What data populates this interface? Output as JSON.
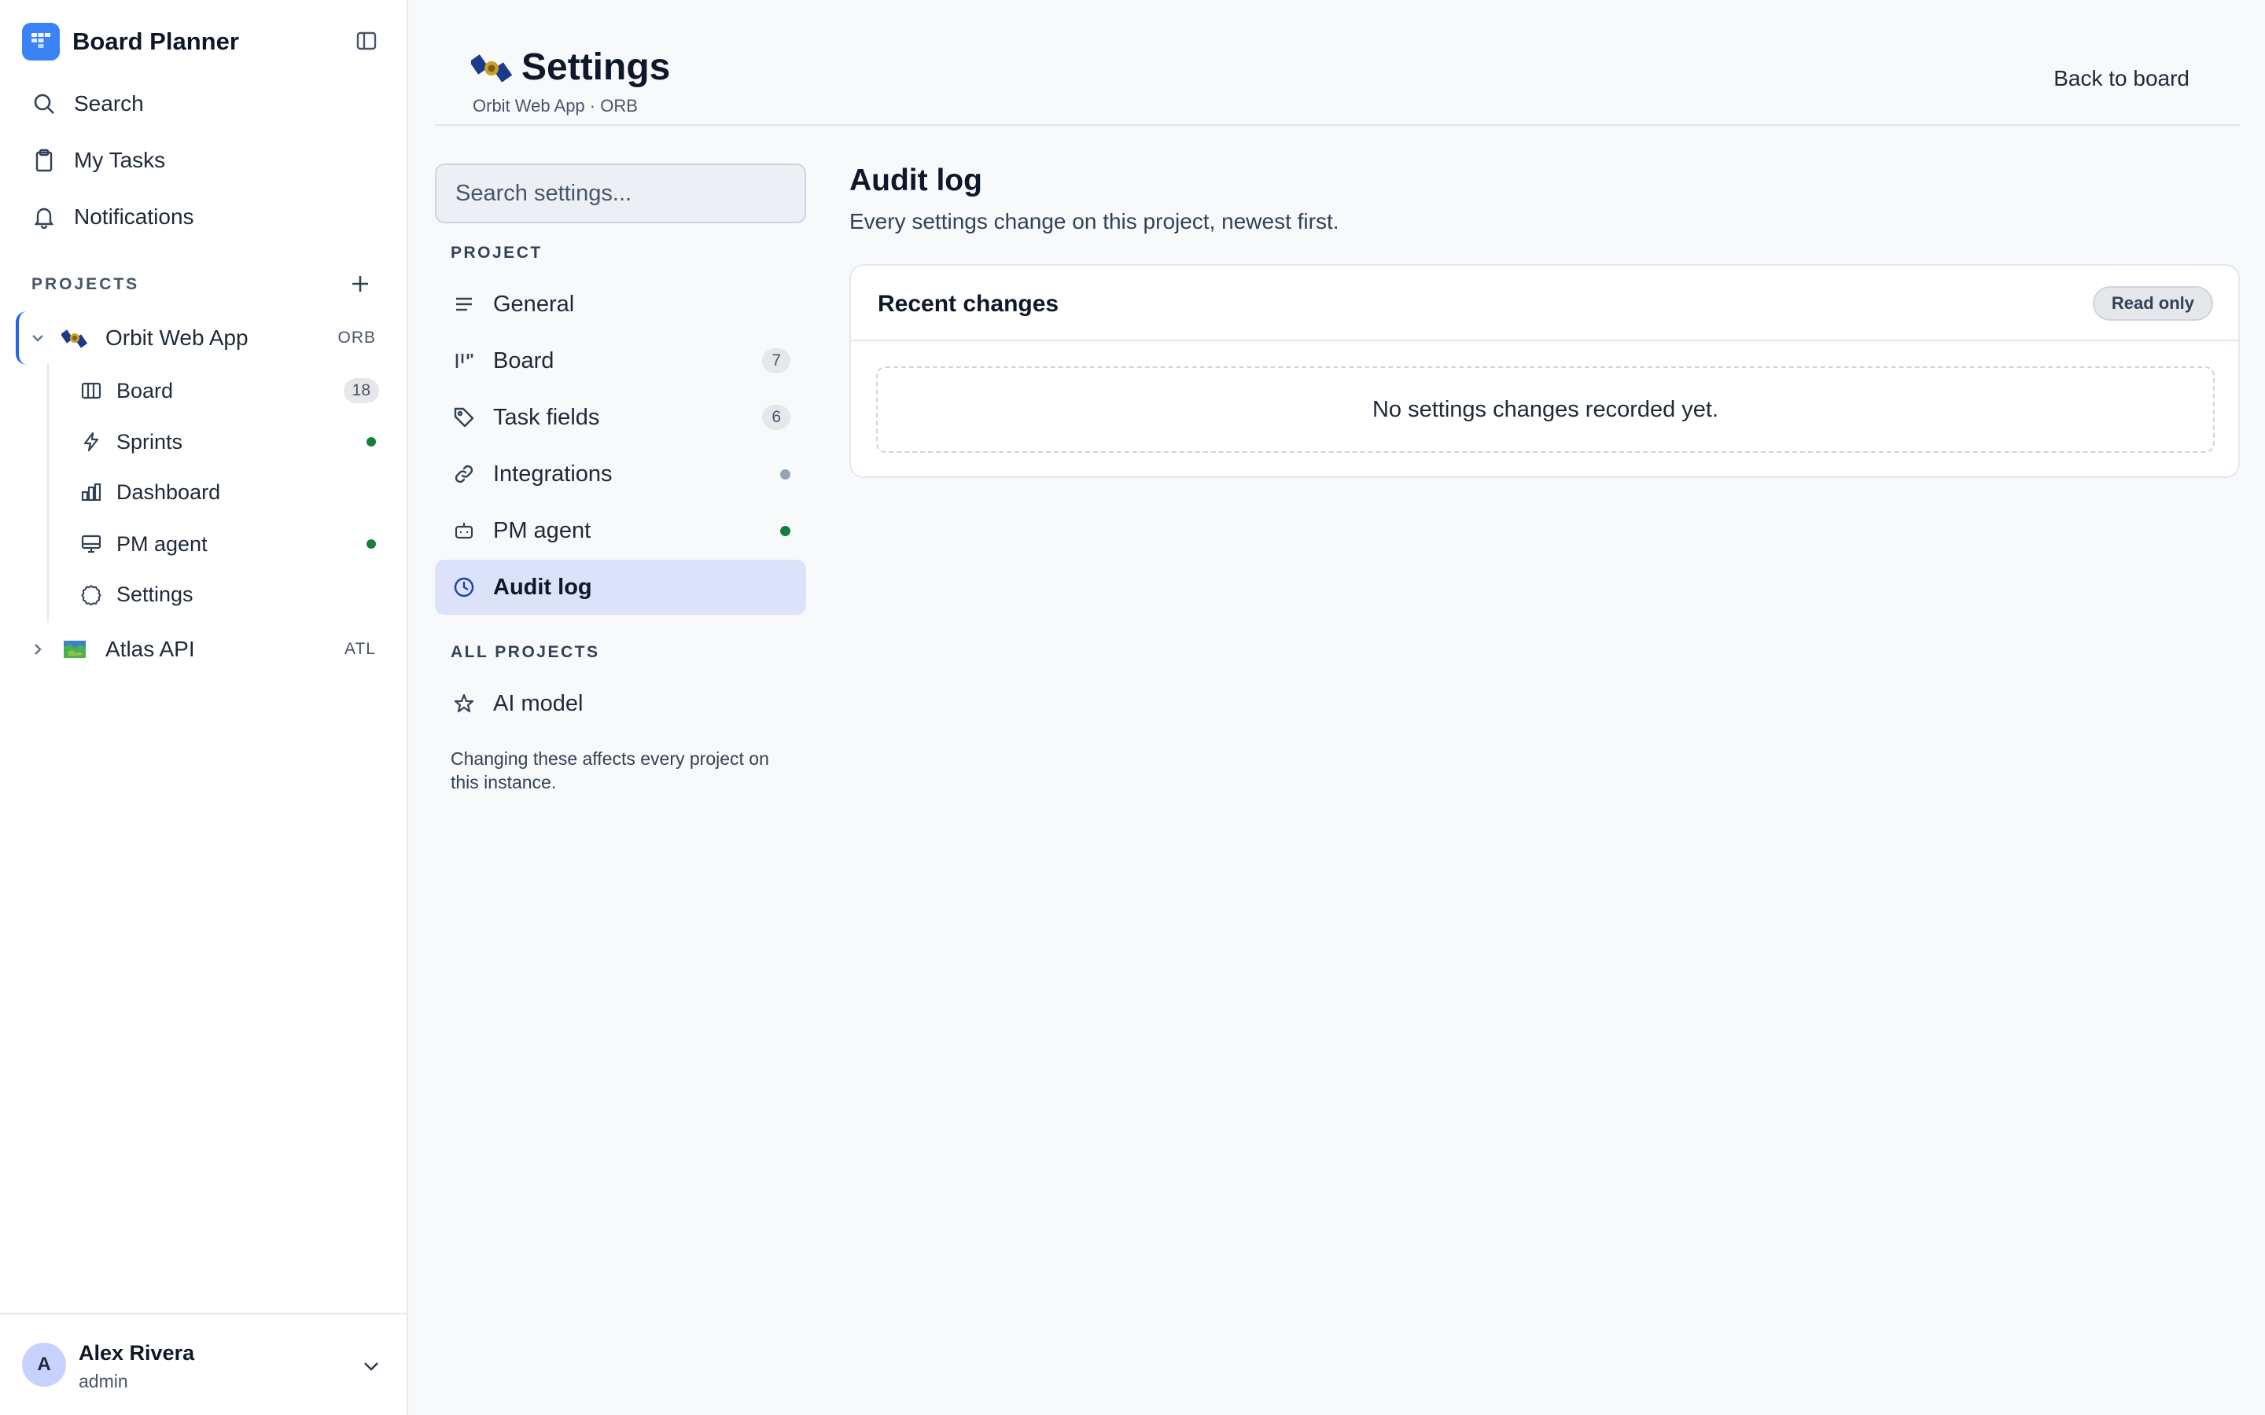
{
  "app": {
    "name": "Board Planner",
    "brand_color": "#3b82f6"
  },
  "sidebar": {
    "nav": [
      {
        "label": "Search",
        "icon": "search-icon"
      },
      {
        "label": "My Tasks",
        "icon": "clipboard-icon"
      },
      {
        "label": "Notifications",
        "icon": "bell-icon"
      }
    ],
    "projects_header": "PROJECTS",
    "projects": [
      {
        "name": "Orbit Web App",
        "key": "ORB",
        "icon": "satellite-emoji-icon",
        "expanded": true,
        "children": [
          {
            "label": "Board",
            "icon": "columns-icon",
            "count": "18"
          },
          {
            "label": "Sprints",
            "icon": "lightning-icon",
            "status_color": "#15803d"
          },
          {
            "label": "Dashboard",
            "icon": "bar-chart-icon"
          },
          {
            "label": "PM agent",
            "icon": "monitor-icon",
            "status_color": "#15803d"
          },
          {
            "label": "Settings",
            "icon": "gear-icon"
          }
        ]
      },
      {
        "name": "Atlas API",
        "key": "ATL",
        "icon": "map-emoji-icon",
        "expanded": false
      }
    ],
    "user": {
      "initial": "A",
      "name": "Alex Rivera",
      "role": "admin"
    }
  },
  "header": {
    "title": "Settings",
    "subtitle": "Orbit Web App · ORB",
    "back_label": "Back to board"
  },
  "settings_nav": {
    "search_placeholder": "Search settings...",
    "project_header": "PROJECT",
    "project_items": [
      {
        "label": "General",
        "icon": "lines-icon"
      },
      {
        "label": "Board",
        "icon": "kanban-icon",
        "count": "7"
      },
      {
        "label": "Task fields",
        "icon": "tag-icon",
        "count": "6"
      },
      {
        "label": "Integrations",
        "icon": "link-icon",
        "status_color": "#94a3b8"
      },
      {
        "label": "PM agent",
        "icon": "robot-icon",
        "status_color": "#15803d"
      },
      {
        "label": "Audit log",
        "icon": "clock-icon",
        "selected": true
      }
    ],
    "all_projects_header": "ALL PROJECTS",
    "all_projects_items": [
      {
        "label": "AI model",
        "icon": "star-icon"
      }
    ],
    "note": "Changing these affects every project on this instance."
  },
  "content": {
    "title": "Audit log",
    "description": "Every settings change on this project, newest first.",
    "card": {
      "title": "Recent changes",
      "badge": "Read only",
      "empty_message": "No settings changes recorded yet."
    }
  }
}
